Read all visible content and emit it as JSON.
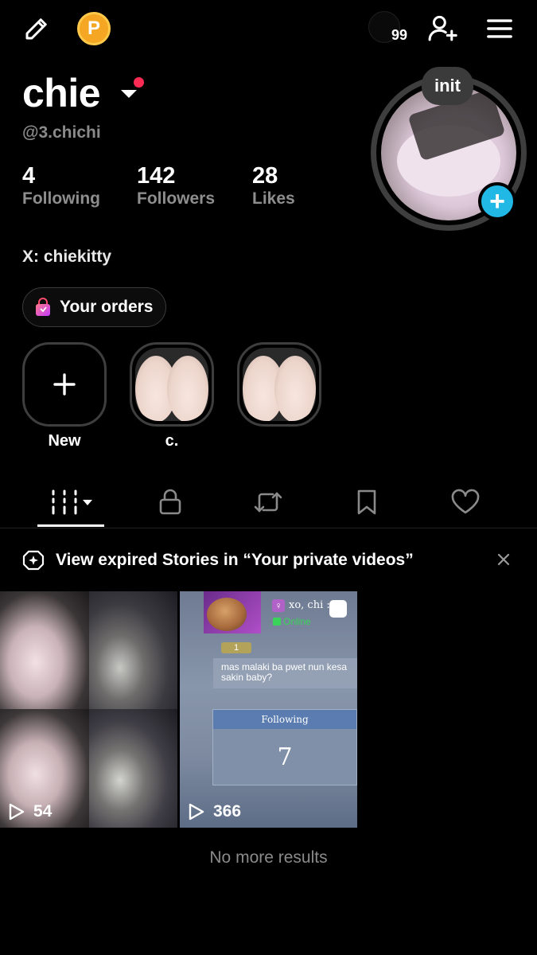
{
  "top_bar": {
    "coin_letter": "P",
    "notification_count": "99"
  },
  "profile": {
    "name": "chie",
    "handle": "@3.chichi",
    "stats": [
      {
        "value": "4",
        "label": "Following"
      },
      {
        "value": "142",
        "label": "Followers"
      },
      {
        "value": "28",
        "label": "Likes"
      }
    ],
    "bio": "X: chiekitty",
    "orders_label": "Your orders",
    "avatar_note": "init"
  },
  "highlights": [
    {
      "label": "New"
    },
    {
      "label": "c."
    },
    {
      "label": ""
    }
  ],
  "tabs": [
    "videos",
    "private",
    "reposts",
    "favorites",
    "liked"
  ],
  "banner": {
    "text": "View expired Stories in “Your private videos”"
  },
  "videos": [
    {
      "views": "54"
    },
    {
      "views": "366",
      "overlay": {
        "user": "xo, chi :",
        "status": "Online",
        "level": "1",
        "message": "mas malaki ba pwet nun kesa sakin baby?",
        "card_label": "Following",
        "card_value": "7"
      }
    }
  ],
  "footer": {
    "no_more": "No more results"
  },
  "colors": {
    "accent_blue": "#21b8e6",
    "coin": "#f5a623",
    "live_dot": "#fe2c55",
    "orders_icon": "#ff4c6e"
  }
}
